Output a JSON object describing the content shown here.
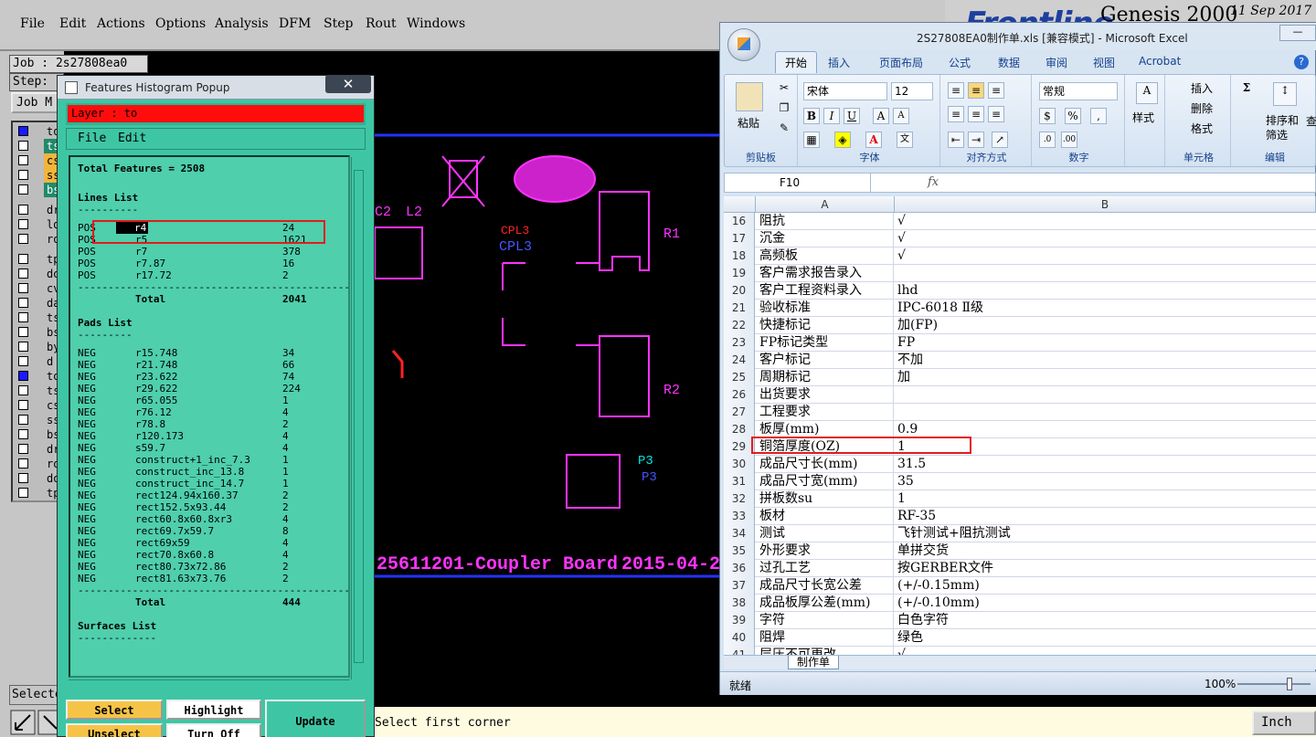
{
  "genesis": {
    "menu": [
      "File",
      "Edit",
      "Actions",
      "Options",
      "Analysis",
      "DFM",
      "Step",
      "Rout",
      "Windows"
    ],
    "brand": {
      "logo": "Frontline",
      "product": "Genesis 2000",
      "date": "11 Sep 2017"
    },
    "job": "Job : 2s27808ea0",
    "step": "Step:",
    "job_matrix_button": "Job M",
    "layers": [
      "to",
      "ts",
      "cs",
      "ss",
      "bs",
      "dr",
      "ld",
      "ro",
      "tp",
      "do",
      "cv",
      "da",
      "ts",
      "bs",
      "by",
      "d",
      "to",
      "ts",
      "cs",
      "ss",
      "bs",
      "dr",
      "ro",
      "do",
      "tp"
    ],
    "selected_label": "Selecte",
    "status_text": "Select first corner",
    "units_button": "Inch",
    "canvas": {
      "labels": [
        "C2",
        "L2",
        "CPL3",
        "CPL3",
        "R1",
        "R2",
        "P3",
        "P3"
      ],
      "board_title": "25611201-Coupler Board",
      "board_date": "2015-04-2"
    }
  },
  "histogram": {
    "title": "Features Histogram Popup",
    "close": "✕",
    "layer_field": "Layer :  to",
    "menu": [
      "File",
      "Edit"
    ],
    "total_features": "Total Features = 2508",
    "lines_title": "Lines List",
    "lines_underline": "----------",
    "lines": [
      [
        "POS",
        "r4",
        "24"
      ],
      [
        "POS",
        "r5",
        "1621"
      ],
      [
        "POS",
        "r7",
        "378"
      ],
      [
        "POS",
        "r7.87",
        "16"
      ],
      [
        "POS",
        "r17.72",
        "2"
      ]
    ],
    "lines_total": [
      "Total",
      "2041"
    ],
    "pads_title": "Pads List",
    "pads_underline": "---------",
    "pads": [
      [
        "NEG",
        "r15.748",
        "34"
      ],
      [
        "NEG",
        "r21.748",
        "66"
      ],
      [
        "NEG",
        "r23.622",
        "74"
      ],
      [
        "NEG",
        "r29.622",
        "224"
      ],
      [
        "NEG",
        "r65.055",
        "1"
      ],
      [
        "NEG",
        "r76.12",
        "4"
      ],
      [
        "NEG",
        "r78.8",
        "2"
      ],
      [
        "NEG",
        "r120.173",
        "4"
      ],
      [
        "NEG",
        "s59.7",
        "4"
      ],
      [
        "NEG",
        "construct+1_inc_7.3",
        "1"
      ],
      [
        "NEG",
        "construct_inc_13.8",
        "1"
      ],
      [
        "NEG",
        "construct_inc_14.7",
        "1"
      ],
      [
        "NEG",
        "rect124.94x160.37",
        "2"
      ],
      [
        "NEG",
        "rect152.5x93.44",
        "2"
      ],
      [
        "NEG",
        "rect60.8x60.8xr3",
        "4"
      ],
      [
        "NEG",
        "rect69.7x59.7",
        "8"
      ],
      [
        "NEG",
        "rect69x59",
        "4"
      ],
      [
        "NEG",
        "rect70.8x60.8",
        "4"
      ],
      [
        "NEG",
        "rect80.73x72.86",
        "2"
      ],
      [
        "NEG",
        "rect81.63x73.76",
        "2"
      ]
    ],
    "pads_total": [
      "Total",
      "444"
    ],
    "surfaces_title": "Surfaces List",
    "surfaces_underline": "-------------",
    "separator": "---------------------------------------------",
    "buttons": {
      "select": "Select",
      "highlight": "Highlight",
      "unselect": "Unselect",
      "turn_off": "Turn Off",
      "update": "Update"
    }
  },
  "excel": {
    "title": "2S27808EA0制作单.xls  [兼容模式] - Microsoft Excel",
    "tabs": [
      "开始",
      "插入",
      "页面布局",
      "公式",
      "数据",
      "审阅",
      "视图",
      "Acrobat"
    ],
    "ribbon": {
      "paste": "粘贴",
      "clipboard": "剪贴板",
      "font_name": "宋体",
      "font_size": "12",
      "font_group": "字体",
      "align_group": "对齐方式",
      "number_format": "常规",
      "number_group": "数字",
      "style": "样式",
      "insert": "插入",
      "delete": "删除",
      "format": "格式",
      "cells_group": "单元格",
      "sort_filter": "排序和筛选",
      "find": "查",
      "edit_group": "编辑"
    },
    "name_box": "F10",
    "fx": "fx",
    "columns": [
      "A",
      "B"
    ],
    "rows": [
      [
        "16",
        "阻抗",
        "√"
      ],
      [
        "17",
        "沉金",
        "√"
      ],
      [
        "18",
        "高频板",
        "√"
      ],
      [
        "19",
        "客户需求报告录入",
        ""
      ],
      [
        "20",
        "客户工程资料录入",
        "lhd"
      ],
      [
        "21",
        "验收标准",
        "IPC-6018 Ⅱ级"
      ],
      [
        "22",
        "快捷标记",
        "加(FP)"
      ],
      [
        "23",
        "FP标记类型",
        "FP"
      ],
      [
        "24",
        "客户标记",
        "不加"
      ],
      [
        "25",
        "周期标记",
        "加"
      ],
      [
        "26",
        "出货要求",
        ""
      ],
      [
        "27",
        "工程要求",
        ""
      ],
      [
        "28",
        "板厚(mm)",
        "0.9"
      ],
      [
        "29",
        "铜箔厚度(OZ)",
        "1"
      ],
      [
        "30",
        "成品尺寸长(mm)",
        "31.5"
      ],
      [
        "31",
        "成品尺寸宽(mm)",
        "35"
      ],
      [
        "32",
        "拼板数su",
        "1"
      ],
      [
        "33",
        "板材",
        "RF-35"
      ],
      [
        "34",
        "测试",
        "飞针测试+阻抗测试"
      ],
      [
        "35",
        "外形要求",
        "单拼交货"
      ],
      [
        "36",
        "过孔工艺",
        "按GERBER文件"
      ],
      [
        "37",
        "成品尺寸长宽公差",
        "(+/-0.15mm)"
      ],
      [
        "38",
        "成品板厚公差(mm)",
        "(+/-0.10mm)"
      ],
      [
        "39",
        "字符",
        "白色字符"
      ],
      [
        "40",
        "阻焊",
        "绿色"
      ],
      [
        "41",
        "层压不可更改",
        "√"
      ]
    ],
    "sheet_tab": "制作单",
    "status": "就绪",
    "zoom": "100%"
  }
}
